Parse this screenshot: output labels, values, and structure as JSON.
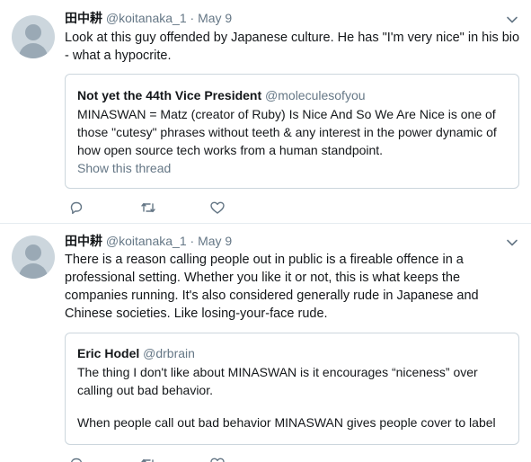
{
  "tweets": [
    {
      "display_name": "田中耕",
      "handle": "@koitanaka_1",
      "separator": "·",
      "time": "May 9",
      "text": "Look at this guy offended by Japanese culture. He has \"I'm very nice\" in his bio - what a hypocrite.",
      "quote": {
        "display_name": "Not yet the 44th Vice President",
        "handle": "@moleculesofyou",
        "text": "MINASWAN = Matz (creator of Ruby) Is Nice And So We Are Nice is one of those \"cutesy\" phrases without teeth & any interest in the power dynamic of how open source tech works from a human standpoint.",
        "link": "Show this thread"
      }
    },
    {
      "display_name": "田中耕",
      "handle": "@koitanaka_1",
      "separator": "·",
      "time": "May 9",
      "text": "There is a reason calling people out in public is a fireable offence in a professional setting. Whether you like it or not, this is what keeps the companies running. It's also considered generally rude in Japanese and Chinese societies. Like losing-your-face rude.",
      "quote": {
        "display_name": "Eric Hodel",
        "handle": "@drbrain",
        "text_p1": "The thing I don't like about MINASWAN is it encourages “niceness” over calling out bad behavior.",
        "text_p2": "When people call out bad behavior MINASWAN gives people cover to label"
      }
    }
  ],
  "icons": {
    "reply": "reply-icon",
    "retweet": "retweet-icon",
    "like": "like-icon",
    "menu": "chevron-down-icon",
    "avatar": "default-avatar-icon"
  },
  "colors": {
    "text": "#14171a",
    "secondary": "#657786",
    "border": "#ccd6dd",
    "divider": "#e6ecf0",
    "avatar_bg": "#ccd6dd"
  }
}
